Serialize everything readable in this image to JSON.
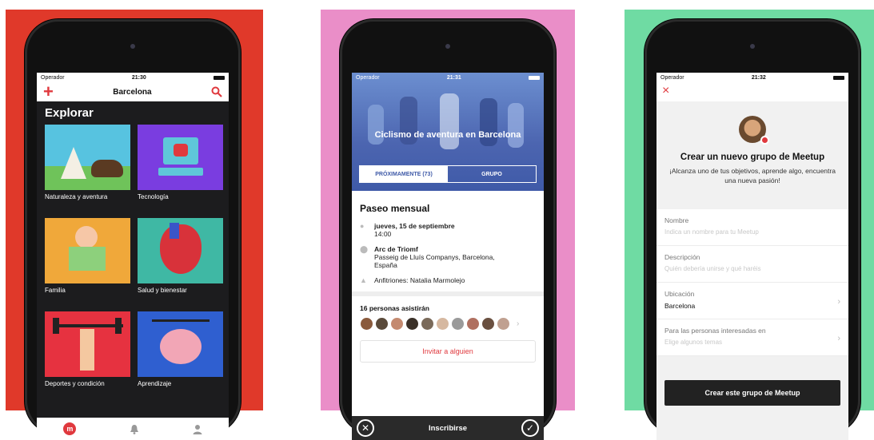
{
  "colors": {
    "red": "#e0392a",
    "pink": "#ea8ec8",
    "green": "#6fdba3",
    "meetup_red": "#e0393e"
  },
  "screen1": {
    "status": {
      "carrier": "Operador",
      "time": "21:30"
    },
    "nav": {
      "add_icon": "+",
      "title": "Barcelona",
      "search_icon": "search-icon"
    },
    "heading": "Explorar",
    "categories": [
      {
        "label": "Naturaleza y aventura"
      },
      {
        "label": "Tecnología"
      },
      {
        "label": "Familia"
      },
      {
        "label": "Salud y bienestar"
      },
      {
        "label": "Deportes y condición"
      },
      {
        "label": "Aprendizaje"
      }
    ],
    "tabs": [
      "meetup-logo-icon",
      "bell-icon",
      "profile-icon"
    ]
  },
  "screen2": {
    "status": {
      "carrier": "Operador",
      "time": "21:31"
    },
    "group_title": "Ciclismo de aventura en Barcelona",
    "tabs": {
      "upcoming": "PRÓXIMAMENTE (73)",
      "group": "GRUPO"
    },
    "event_title": "Paseo mensual",
    "date": "jueves, 15 de septiembre",
    "time": "14:00",
    "venue": "Arc de Triomf",
    "address": "Passeig de Lluís Companys, Barcelona, España",
    "hosts": "Anfitriones: Natalia Marmolejo",
    "attendees": "16 personas asistirán",
    "invite": "Invitar a alguien",
    "join": "Inscribirse"
  },
  "screen3": {
    "status": {
      "carrier": "Operador",
      "time": "21:32"
    },
    "close_icon": "×",
    "title": "Crear un nuevo grupo de Meetup",
    "subtitle": "¡Alcanza uno de tus objetivos, aprende algo, encuentra una nueva pasión!",
    "fields": [
      {
        "label": "Nombre",
        "placeholder": "Indica un nombre para tu Meetup"
      },
      {
        "label": "Descripción",
        "placeholder": "Quién debería unirse y qué haréis"
      },
      {
        "label": "Ubicación",
        "value": "Barcelona"
      },
      {
        "label": "Para las personas interesadas en",
        "placeholder": "Elige algunos temas"
      }
    ],
    "cta": "Crear este grupo de Meetup"
  }
}
